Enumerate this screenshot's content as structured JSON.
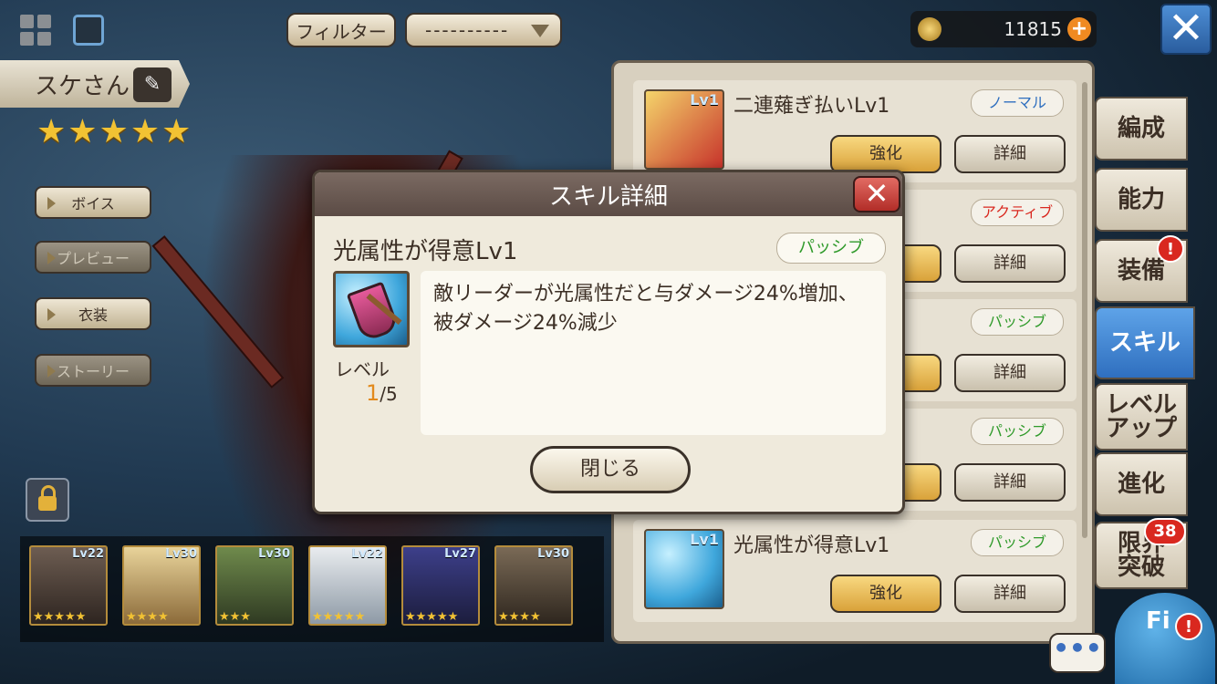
{
  "header": {
    "filter_label": "フィルター",
    "dropdown_value": "----------",
    "gold": "11815",
    "plus_label": "+",
    "close_label": "✕"
  },
  "unit": {
    "name": "スケさん",
    "stars": "★★★★★"
  },
  "side_buttons": [
    {
      "label": "ボイス"
    },
    {
      "label": "プレビュー"
    },
    {
      "label": "衣装"
    },
    {
      "label": "ストーリー"
    }
  ],
  "roster": [
    {
      "level": "Lv22",
      "stars": "★★★★★"
    },
    {
      "level": "Lv30",
      "stars": "★★★★"
    },
    {
      "level": "Lv30",
      "stars": "★★★"
    },
    {
      "level": "Lv22",
      "stars": "★★★★★"
    },
    {
      "level": "Lv27",
      "stars": "★★★★★"
    },
    {
      "level": "Lv30",
      "stars": "★★★★"
    }
  ],
  "skills": [
    {
      "name": "二連薙ぎ払いLv1",
      "tag": "ノーマル",
      "tag_color": "#2f6fbf",
      "enhance": "強化",
      "detail": "詳細",
      "icon_level": "Lv1"
    },
    {
      "name": "",
      "tag": "アクティブ",
      "tag_color": "#d9281f",
      "enhance": "",
      "detail": "詳細"
    },
    {
      "name": "",
      "tag": "パッシブ",
      "tag_color": "#2f9a2a",
      "enhance": "",
      "detail": "詳細"
    },
    {
      "name": "",
      "tag": "パッシブ",
      "tag_color": "#2f9a2a",
      "enhance": "",
      "detail": "詳細"
    },
    {
      "name": "光属性が得意Lv1",
      "tag": "パッシブ",
      "tag_color": "#2f9a2a",
      "enhance": "強化",
      "detail": "詳細",
      "icon_level": "Lv1"
    }
  ],
  "tabs": [
    {
      "label": "編成"
    },
    {
      "label": "能力"
    },
    {
      "label": "装備",
      "badge": "!"
    },
    {
      "label": "スキル",
      "active": true
    },
    {
      "label": "レベル\nアップ"
    },
    {
      "label": "進化"
    },
    {
      "label": "限界\n突破",
      "badge": "38"
    }
  ],
  "field_label": "Fi",
  "chat_label": "•••",
  "modal": {
    "title": "スキル詳細",
    "close_x": "✕",
    "skill_name": "光属性が得意Lv1",
    "type": "パッシブ",
    "level_label": "レベル",
    "level_current": "1",
    "level_max": "/5",
    "description": "敵リーダーが光属性だと与ダメージ24%増加、被ダメージ24%減少",
    "close_button": "閉じる"
  }
}
